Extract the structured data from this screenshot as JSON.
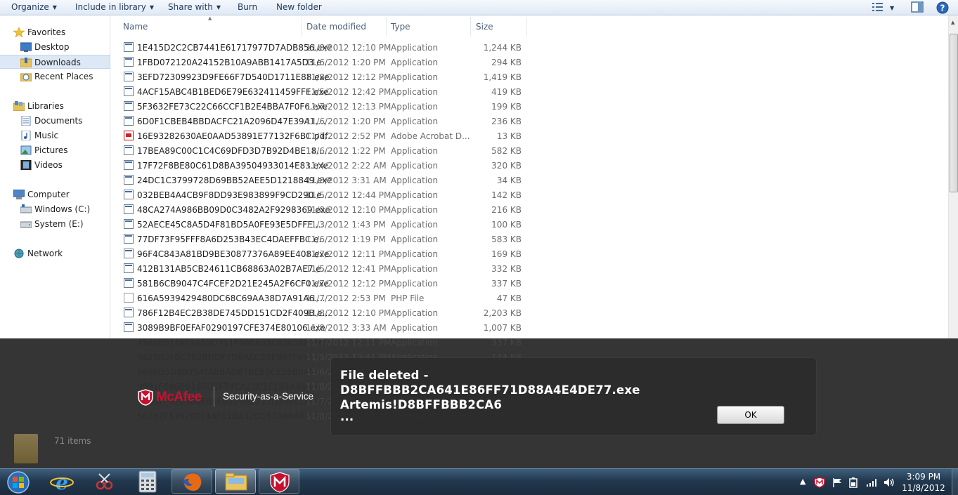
{
  "toolbar": {
    "organize": "Organize",
    "include_in_library": "Include in library",
    "share_with": "Share with",
    "burn": "Burn",
    "new_folder": "New folder"
  },
  "nav": {
    "favorites": "Favorites",
    "desktop": "Desktop",
    "downloads": "Downloads",
    "recent_places": "Recent Places",
    "libraries": "Libraries",
    "documents": "Documents",
    "music": "Music",
    "pictures": "Pictures",
    "videos": "Videos",
    "computer": "Computer",
    "windows_c": "Windows (C:)",
    "system_e": "System (E:)",
    "network": "Network"
  },
  "columns": {
    "name": "Name",
    "date_modified": "Date modified",
    "type": "Type",
    "size": "Size"
  },
  "files": [
    {
      "name": "1E415D2C2CB7441E61717977D7ADB856.exe",
      "date": "11/8/2012 12:10 PM",
      "type": "Application",
      "size": "1,244 KB",
      "icon": "exe"
    },
    {
      "name": "1FBD072120A24152B10A9ABB1417A5D3.e...",
      "date": "11/6/2012 1:20 PM",
      "type": "Application",
      "size": "294 KB",
      "icon": "exe"
    },
    {
      "name": "3EFD72309923D9FE66F7D540D1711E88.exe",
      "date": "11/8/2012 12:12 PM",
      "type": "Application",
      "size": "1,419 KB",
      "icon": "exe"
    },
    {
      "name": "4ACF15ABC4B1BED6E79E632411459FFE.exe",
      "date": "11/5/2012 12:42 PM",
      "type": "Application",
      "size": "419 KB",
      "icon": "exe"
    },
    {
      "name": "5F3632FE73C22C66CCF1B2E4BBA7F0F6.exe",
      "date": "11/7/2012 12:13 PM",
      "type": "Application",
      "size": "199 KB",
      "icon": "exe"
    },
    {
      "name": "6D0F1CBEB4BBDACFC21A2096D47E39A1....",
      "date": "11/6/2012 1:20 PM",
      "type": "Application",
      "size": "236 KB",
      "icon": "exe"
    },
    {
      "name": "16E93282630AE0AAD53891E77132F6BC.pdf",
      "date": "11/7/2012 2:52 PM",
      "type": "Adobe Acrobat D...",
      "size": "13 KB",
      "icon": "pdf"
    },
    {
      "name": "17BEA89C00C1C4C69DFD3D7B92D4BE18....",
      "date": "11/6/2012 1:22 PM",
      "type": "Application",
      "size": "582 KB",
      "icon": "exe"
    },
    {
      "name": "17F72F8BE80C61D8BA39504933014E83.exe",
      "date": "11/4/2012 2:22 AM",
      "type": "Application",
      "size": "320 KB",
      "icon": "exe"
    },
    {
      "name": "24DC1C3799728D69BB52AEE5D1218849.exe",
      "date": "11/8/2012 3:31 AM",
      "type": "Application",
      "size": "34 KB",
      "icon": "exe"
    },
    {
      "name": "032BEB4A4CB9F8DD93E983899F9CD290.e...",
      "date": "11/5/2012 12:44 PM",
      "type": "Application",
      "size": "142 KB",
      "icon": "exe"
    },
    {
      "name": "48CA274A986BB09D0C3482A2F9298369.exe",
      "date": "11/8/2012 12:10 PM",
      "type": "Application",
      "size": "216 KB",
      "icon": "exe"
    },
    {
      "name": "52AECE45C8A5D4F81BD5A0FE93E5DFFE....",
      "date": "11/3/2012 1:43 PM",
      "type": "Application",
      "size": "100 KB",
      "icon": "exe"
    },
    {
      "name": "77DF73F95FFF8A6D253B43EC4DAEFFBC.e...",
      "date": "11/6/2012 1:19 PM",
      "type": "Application",
      "size": "583 KB",
      "icon": "exe"
    },
    {
      "name": "96F4C843A81BD9BE30877376A89EE408.exe",
      "date": "11/7/2012 12:11 PM",
      "type": "Application",
      "size": "169 KB",
      "icon": "exe"
    },
    {
      "name": "412B131AB5CB24611CB68863A02B7AE7.e...",
      "date": "11/5/2012 12:41 PM",
      "type": "Application",
      "size": "332 KB",
      "icon": "exe"
    },
    {
      "name": "581B6CB9047C4FCEF2D21E245A2F6CF0.exe",
      "date": "11/7/2012 12:12 PM",
      "type": "Application",
      "size": "337 KB",
      "icon": "exe"
    },
    {
      "name": "616A5939429480DC68C69AA38D7A91A6....",
      "date": "11/7/2012 2:53 PM",
      "type": "PHP File",
      "size": "47 KB",
      "icon": "php"
    },
    {
      "name": "786F12B4EC2B38DE745DD151CD2F409B.e...",
      "date": "11/8/2012 12:10 PM",
      "type": "Application",
      "size": "2,203 KB",
      "icon": "exe"
    },
    {
      "name": "3089B9BF0EFAF0290197CFE374E80106.exe",
      "date": "11/8/2012 3:33 AM",
      "type": "Application",
      "size": "1,007 KB",
      "icon": "exe"
    }
  ],
  "dimmed_files": [
    {
      "name": "7580B51FAFAA59D711F966835C63058B.exe",
      "date": "11/7/2012 12:11 PM",
      "type": "Application",
      "size": "337 KB"
    },
    {
      "name": "9425B2FBC702BDDF7DBAEC25E867F99E.e...",
      "date": "11/5/2012 12:41 PM",
      "type": "Application",
      "size": "144 KB"
    },
    {
      "name": "9696D5D8B754FA8BAD87BEB5CE55B045....",
      "date": "11/6/2012 1:20 PM",
      "type": "Application",
      "size": "324 KB"
    },
    {
      "name": "9981F686B6185D1F74CA21C1E1B4A46.exe",
      "date": "11/8/2012 12:10 PM",
      "type": "Application",
      "size": "215 KB"
    },
    {
      "name": "54597F92E988EB6FB229B2723D28BCD3.exe",
      "date": "11/7/2012 12:13 PM",
      "type": "Application",
      "size": "336 KB"
    },
    {
      "name": "56162F576200F14F01BA320D52A8BAB2.exe",
      "date": "11/8/2012 12:15 PM",
      "type": "Application",
      "size": "1,148 KB"
    }
  ],
  "status": {
    "item_count": "71 items"
  },
  "mcafee": {
    "brand": "McAfee",
    "tagline": "Security-as-a-Service"
  },
  "dialog": {
    "line1": "File deleted -",
    "line2": "D8BFFBBB2CA641E86FF71D88A4E4DE77.exe",
    "line3": "Artemis!D8BFFBBB2CA6",
    "line4": "...",
    "ok": "OK"
  },
  "taskbar": {
    "time": "3:09 PM",
    "date": "11/8/2012"
  },
  "colors": {
    "mcafee_red": "#c8102e",
    "taskbar": "#22384e",
    "selection": "#dde8f6"
  }
}
